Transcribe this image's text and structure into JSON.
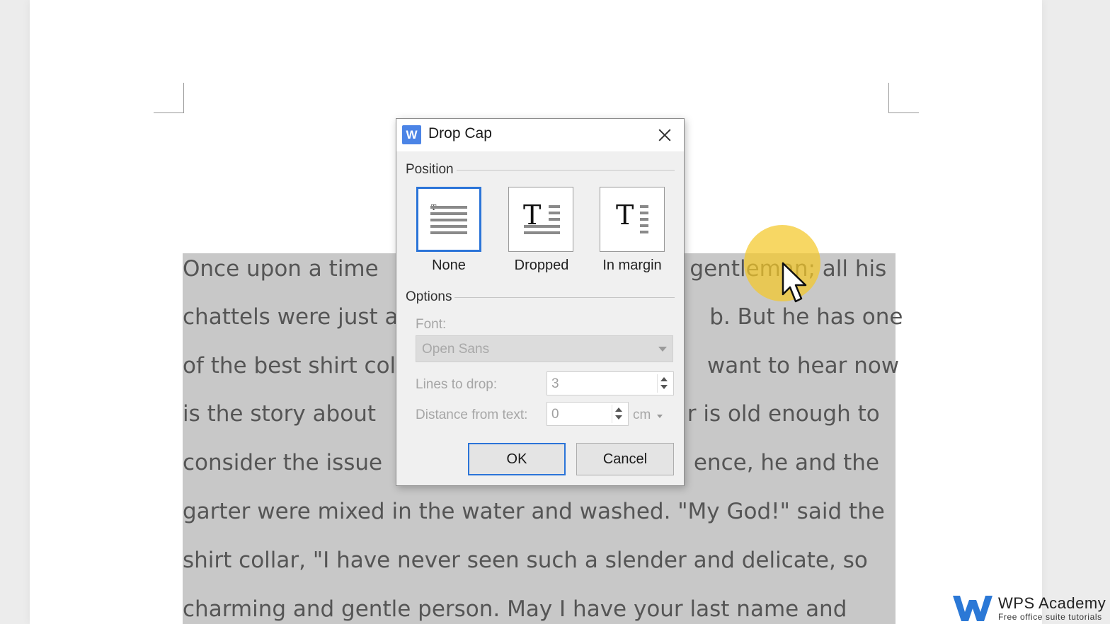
{
  "document": {
    "lines": [
      [
        "Once upon a time",
        "gentleman; all his"
      ],
      [
        "chattels were just a",
        "b. But he has one"
      ],
      [
        "of the best shirt col",
        "want to hear now"
      ],
      [
        "is the story about",
        "r is old enough to"
      ],
      [
        "consider the issue",
        "ence, he and the"
      ],
      [
        "garter were mixed in the water and washed. \"My God!\" said the"
      ],
      [
        "shirt collar, \"I have never seen such a slender and delicate, so"
      ],
      [
        "charming and gentle person. May I have your last name and"
      ]
    ]
  },
  "dialog": {
    "app_icon_letter": "W",
    "title": "Drop Cap",
    "position_group": "Position",
    "positions": [
      {
        "label": "None",
        "selected": true
      },
      {
        "label": "Dropped",
        "selected": false
      },
      {
        "label": "In margin",
        "selected": false
      }
    ],
    "options_group": "Options",
    "font_label": "Font:",
    "font_value": "Open Sans",
    "lines_label": "Lines to drop:",
    "lines_value": "3",
    "distance_label": "Distance from text:",
    "distance_value": "0",
    "distance_unit": "cm",
    "ok_label": "OK",
    "cancel_label": "Cancel"
  },
  "watermark": {
    "title": "WPS Academy",
    "subtitle": "Free office suite tutorials"
  },
  "colors": {
    "accent": "#2b74d8",
    "selection": "#c8c8c8",
    "cursor_halo": "#f4c828"
  }
}
